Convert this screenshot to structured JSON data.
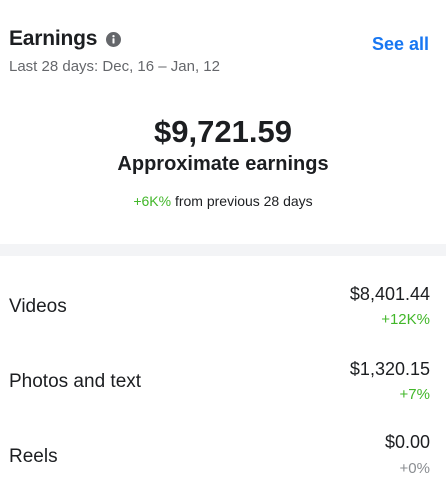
{
  "header": {
    "title": "Earnings",
    "info_icon": "info-icon",
    "date_range": "Last 28 days: Dec, 16 – Jan, 12",
    "see_all_label": "See all"
  },
  "summary": {
    "amount": "$9,721.59",
    "label": "Approximate earnings",
    "change_value": "+6K%",
    "change_text": "from previous 28 days"
  },
  "breakdown": [
    {
      "label": "Videos",
      "amount": "$8,401.44",
      "change": "+12K%",
      "change_color": "#42b72a"
    },
    {
      "label": "Photos and text",
      "amount": "$1,320.15",
      "change": "+7%",
      "change_color": "#42b72a"
    },
    {
      "label": "Reels",
      "amount": "$0.00",
      "change": "+0%",
      "change_color": "#8a8d91"
    }
  ],
  "colors": {
    "accent": "#1877f2",
    "positive": "#42b72a",
    "muted": "#65676b"
  }
}
